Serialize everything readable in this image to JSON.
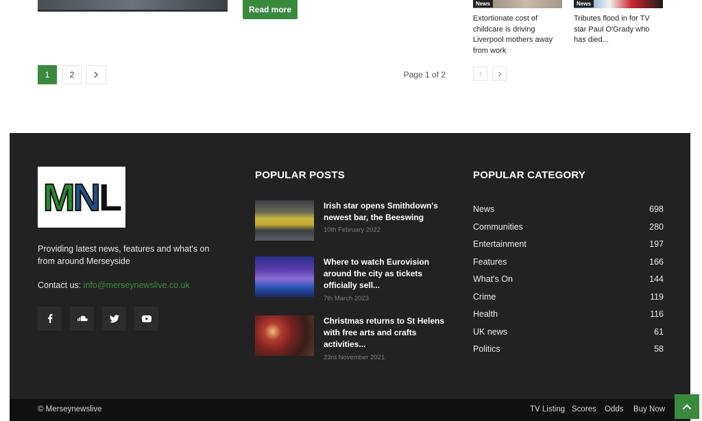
{
  "content": {
    "read_more_label": "Read more",
    "pagination": {
      "pages": [
        "1",
        "2"
      ],
      "next_icon": "chevron-right-icon",
      "page_info": "Page 1 of 2"
    },
    "related_posts": [
      {
        "tag": "News",
        "title": "Extortionate cost of childcare is driving Liverpool mothers away from work"
      },
      {
        "tag": "News",
        "title": "Tributes flood in for TV star Paul O'Grady who has died..."
      }
    ],
    "related_nav": {
      "prev_icon": "chevron-left-icon",
      "next_icon": "chevron-right-icon"
    }
  },
  "footer": {
    "logo_text": {
      "m": "M",
      "n": "N",
      "l": "L"
    },
    "about": "Providing latest news, features and what's on from around Merseyside",
    "contact_label": "Contact us: ",
    "contact_email": "info@merseynewslive.co.uk",
    "social_icons": [
      "facebook-icon",
      "soundcloud-icon",
      "twitter-icon",
      "youtube-icon"
    ],
    "popular_posts_title": "POPULAR POSTS",
    "popular_posts": [
      {
        "title": "Irish star opens Smithdown's newest bar, the Beeswing",
        "date": "10th February 2022"
      },
      {
        "title": "Where to watch Eurovision around the city as tickets officially sell...",
        "date": "7th March 2023"
      },
      {
        "title": "Christmas returns to St Helens with free arts and crafts activities...",
        "date": "23rd November 2021"
      }
    ],
    "popular_category_title": "POPULAR CATEGORY",
    "categories": [
      {
        "name": "News",
        "count": "698"
      },
      {
        "name": "Communities",
        "count": "280"
      },
      {
        "name": "Entertainment",
        "count": "197"
      },
      {
        "name": "Features",
        "count": "166"
      },
      {
        "name": "What's On",
        "count": "144"
      },
      {
        "name": "Crime",
        "count": "119"
      },
      {
        "name": "Health",
        "count": "116"
      },
      {
        "name": "UK news",
        "count": "61"
      },
      {
        "name": "Politics",
        "count": "58"
      }
    ]
  },
  "bottom_bar": {
    "copyright": "© Merseynewslive",
    "links": [
      "TV Listing",
      "Scores",
      "Odds",
      "Buy Now"
    ],
    "to_top_icon": "arrow-up-icon"
  },
  "colors": {
    "accent": "#3a8a3e",
    "footer_bg": "#222222",
    "bottom_bg": "#111111"
  }
}
